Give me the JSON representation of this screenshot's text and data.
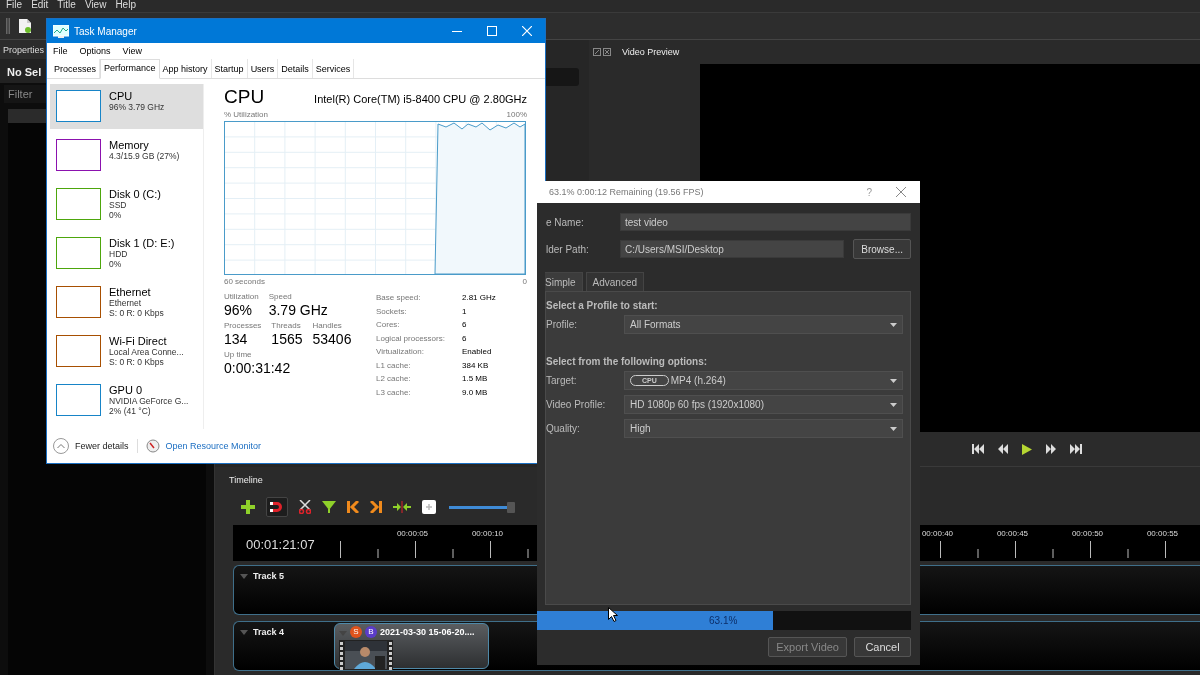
{
  "app": {
    "menu": [
      "File",
      "Edit",
      "Title",
      "View",
      "Help"
    ],
    "properties_panel": {
      "tab": "Properties",
      "heading": "No Sel",
      "filter_placeholder": "Filter"
    },
    "video_preview": {
      "title": "Video Preview"
    },
    "timeline": {
      "title": "Timeline",
      "zoom": {
        "level": 0.94
      },
      "timecode": "00:01:21:07",
      "ruler_left": [
        "00:00:05",
        "00:00:10"
      ],
      "ruler_right": [
        "00:00:40",
        "00:00:45",
        "00:00:50",
        "00:00:55"
      ],
      "tracks": [
        {
          "name": "Track 5"
        },
        {
          "name": "Track 4",
          "clip": {
            "title": "2021-03-30 15-06-20....",
            "badges": [
              {
                "label": "S",
                "color": "#e0531c"
              },
              {
                "label": "B",
                "color": "#5b3cc8"
              }
            ]
          }
        }
      ]
    }
  },
  "task_manager": {
    "title": "Task Manager",
    "menu": [
      "File",
      "Options",
      "View"
    ],
    "tabs": [
      {
        "label": "Processes",
        "selected": false
      },
      {
        "label": "Performance",
        "selected": true
      },
      {
        "label": "App history",
        "selected": false
      },
      {
        "label": "Startup",
        "selected": false
      },
      {
        "label": "Users",
        "selected": false
      },
      {
        "label": "Details",
        "selected": false
      },
      {
        "label": "Services",
        "selected": false
      }
    ],
    "resources": [
      {
        "name": "CPU",
        "lines": [
          "96%  3.79 GHz"
        ],
        "color": "#1784c7",
        "selected": true
      },
      {
        "name": "Memory",
        "lines": [
          "4.3/15.9 GB (27%)"
        ],
        "color": "#8b12ae",
        "selected": false
      },
      {
        "name": "Disk 0 (C:)",
        "lines": [
          "SSD",
          "0%"
        ],
        "color": "#4da60c",
        "selected": false
      },
      {
        "name": "Disk 1 (D: E:)",
        "lines": [
          "HDD",
          "0%"
        ],
        "color": "#4da60c",
        "selected": false
      },
      {
        "name": "Ethernet",
        "lines": [
          "Ethernet",
          "S: 0 R: 0 Kbps"
        ],
        "color": "#a74f01",
        "selected": false
      },
      {
        "name": "Wi-Fi Direct",
        "lines": [
          "Local Area Conne...",
          "S: 0 R: 0 Kbps"
        ],
        "color": "#a74f01",
        "selected": false
      },
      {
        "name": "GPU 0",
        "lines": [
          "NVIDIA GeForce G...",
          "2% (41 °C)"
        ],
        "color": "#1784c7",
        "selected": false
      }
    ],
    "detail": {
      "title": "CPU",
      "model": "Intel(R) Core(TM) i5-8400 CPU @ 2.80GHz",
      "graph_label": "% Utilization",
      "graph_max": "100%",
      "graph_span": "60 seconds",
      "graph_min": "0",
      "stats": [
        [
          {
            "label": "Utilization",
            "value": "96%"
          },
          {
            "label": "Speed",
            "value": "3.79 GHz"
          }
        ],
        [
          {
            "label": "Processes",
            "value": "134"
          },
          {
            "label": "Threads",
            "value": "1565"
          },
          {
            "label": "Handles",
            "value": "53406"
          }
        ],
        [
          {
            "label": "Up time",
            "value": "0:00:31:42"
          }
        ]
      ],
      "specs": [
        {
          "label": "Base speed:",
          "value": "2.81 GHz"
        },
        {
          "label": "Sockets:",
          "value": "1"
        },
        {
          "label": "Cores:",
          "value": "6"
        },
        {
          "label": "Logical processors:",
          "value": "6"
        },
        {
          "label": "Virtualization:",
          "value": "Enabled"
        },
        {
          "label": "L1 cache:",
          "value": "384 KB"
        },
        {
          "label": "L2 cache:",
          "value": "1.5 MB"
        },
        {
          "label": "L3 cache:",
          "value": "9.0 MB"
        }
      ]
    },
    "footer": {
      "fewer_details": "Fewer details",
      "resource_monitor": "Open Resource Monitor"
    }
  },
  "export_dialog": {
    "title": "63.1%  0:00:12 Remaining (19.56 FPS)",
    "help": "?",
    "fields": [
      {
        "label": "e Name:",
        "value": "test video"
      },
      {
        "label": "lder Path:",
        "value": "C:/Users/MSI/Desktop",
        "button": "Browse..."
      }
    ],
    "tabs": [
      {
        "label": "Simple",
        "selected": true
      },
      {
        "label": "Advanced",
        "selected": false
      }
    ],
    "sections": [
      {
        "heading": "Select a Profile to start:",
        "rows": [
          {
            "label": "Profile:",
            "value": "All Formats"
          }
        ]
      },
      {
        "heading": "Select from the following options:",
        "rows": [
          {
            "label": "Target:",
            "badge": "CPU",
            "value": "MP4 (h.264)"
          },
          {
            "label": "Video Profile:",
            "value": "HD 1080p 60 fps (1920x1080)"
          },
          {
            "label": "Quality:",
            "value": "High"
          }
        ]
      }
    ],
    "progress": {
      "level": 0.631,
      "reading": "63.1%"
    },
    "buttons": [
      {
        "label": "Export Video",
        "disabled": true
      },
      {
        "label": "Cancel",
        "disabled": false
      }
    ]
  }
}
